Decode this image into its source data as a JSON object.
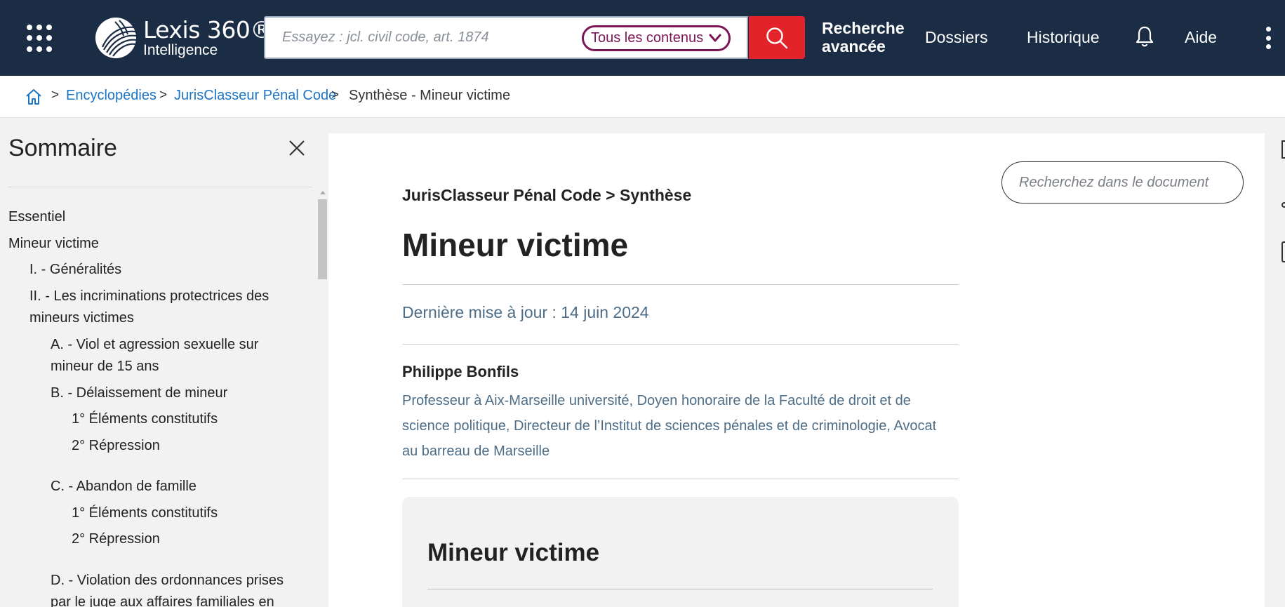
{
  "header": {
    "brand_name": "Lexis 360®",
    "brand_sub": "Intelligence",
    "search_placeholder": "Essayez : jcl. civil code, art. 1874",
    "scope_selected": "Tous les contenus",
    "nav": {
      "advanced_line1": "Recherche",
      "advanced_line2": "avancée",
      "dossiers": "Dossiers",
      "historique": "Historique",
      "aide": "Aide"
    }
  },
  "breadcrumb": {
    "sep": ">",
    "items": [
      "Encyclopédies",
      "JurisClasseur Pénal Code",
      "Synthèse - Mineur victime"
    ]
  },
  "sidebar": {
    "title": "Sommaire",
    "toc": [
      "Essentiel",
      "Mineur victime",
      "I. - Généralités",
      "II. - Les incriminations protectrices des",
      "mineurs victimes",
      "A. - Viol et agression sexuelle sur",
      "mineur de 15 ans",
      "B. - Délaissement de mineur",
      "1° Éléments constitutifs",
      "2° Répression",
      "C. - Abandon de famille",
      "1° Éléments constitutifs",
      "2° Répression",
      "D. - Violation des ordonnances prises",
      "par le juge aux affaires familiales en"
    ]
  },
  "document": {
    "search_placeholder": "Recherchez dans le document",
    "source": "JurisClasseur Pénal Code > Synthèse",
    "title": "Mineur victime",
    "updated": "Dernière mise à jour : 14 juin 2024",
    "author_name": "Philippe Bonfils",
    "author_desc_lines": [
      "Professeur à Aix-Marseille université, Doyen honoraire de la Faculté de droit et de",
      "science politique, Directeur de l’Institut de sciences pénales et de criminologie, Avocat",
      "au barreau de Marseille"
    ],
    "summary_title": "Mineur victime"
  },
  "colors": {
    "header_bg": "#1b2c45",
    "search_button": "#e3232a",
    "scope_accent": "#7b1658",
    "link": "#1b74c4",
    "muted_text": "#4e6d86"
  },
  "icons": [
    "apps-grid-icon",
    "lexis-logo-icon",
    "chevron-down-icon",
    "search-icon",
    "bell-icon",
    "kebab-menu-icon",
    "home-icon",
    "close-icon"
  ]
}
